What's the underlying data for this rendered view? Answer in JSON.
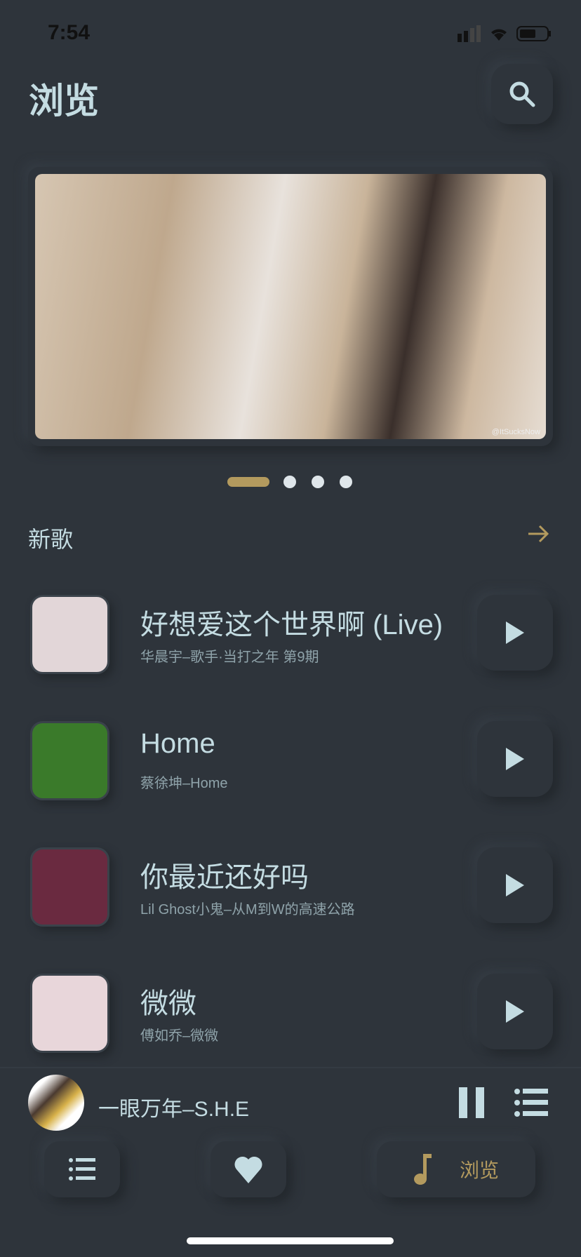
{
  "status": {
    "time": "7:54"
  },
  "header": {
    "title": "浏览",
    "search_icon": "search-icon"
  },
  "banner": {
    "watermark": "@ItSucksNow",
    "page_count": 4,
    "active_page": 1
  },
  "section": {
    "title": "新歌"
  },
  "songs": [
    {
      "title": "好想爱这个世界啊 (Live)",
      "subtitle": "华晨宇–歌手·当打之年 第9期",
      "cover": "#e2d6d8"
    },
    {
      "title": "Home",
      "subtitle": "蔡徐坤–Home",
      "cover": "#3a7a2a"
    },
    {
      "title": "你最近还好吗",
      "subtitle": "Lil Ghost小鬼–从M到W的高速公路",
      "cover": "#6a2a40"
    },
    {
      "title": "微微",
      "subtitle": "傅如乔–微微",
      "cover": "#e8d6da"
    }
  ],
  "player": {
    "now_playing": "一眼万年–S.H.E",
    "state": "playing"
  },
  "nav": {
    "browse_label": "浏览"
  },
  "colors": {
    "bg": "#2e343b",
    "text": "#c4dce2",
    "accent": "#b39a5e"
  }
}
